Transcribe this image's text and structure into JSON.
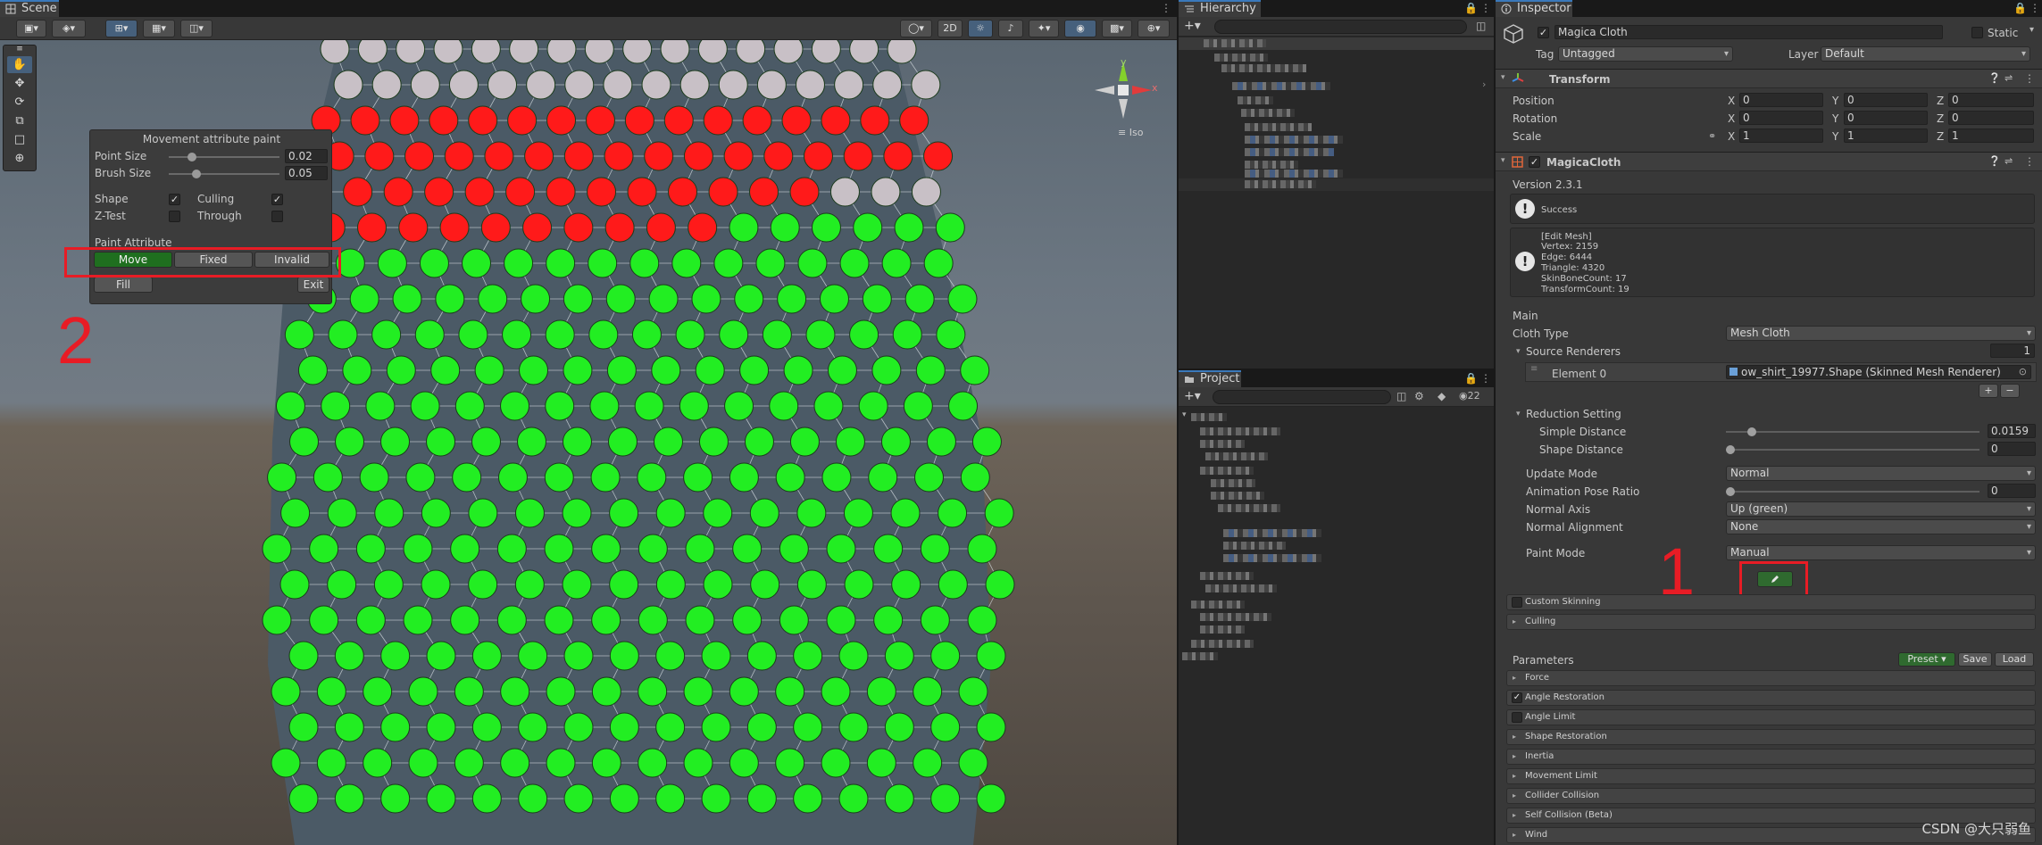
{
  "scene": {
    "tab_label": "Scene",
    "toolbar": {
      "mode_2d": "2D"
    },
    "gizmo": {
      "x_label": "x",
      "y_label": "y",
      "projection": "Iso"
    },
    "colors": {
      "fixed": "#ff1a1a",
      "move": "#22ee22",
      "invalid": "#c8c0c6"
    }
  },
  "paint_panel": {
    "title": "Movement attribute paint",
    "point_size_label": "Point Size",
    "point_size_value": "0.02",
    "brush_size_label": "Brush Size",
    "brush_size_value": "0.05",
    "shape_label": "Shape",
    "culling_label": "Culling",
    "ztest_label": "Z-Test",
    "through_label": "Through",
    "paint_attribute_label": "Paint Attribute",
    "move_label": "Move",
    "fixed_label": "Fixed",
    "invalid_label": "Invalid",
    "fill_label": "Fill",
    "exit_label": "Exit"
  },
  "annotations": {
    "label_1": "1",
    "label_2": "2"
  },
  "hierarchy": {
    "tab_label": "Hierarchy"
  },
  "project": {
    "tab_label": "Project",
    "hidden_count": "22"
  },
  "inspector": {
    "tab_label": "Inspector",
    "object_name": "Magica Cloth",
    "static_label": "Static",
    "tag_label": "Tag",
    "tag_value": "Untagged",
    "layer_label": "Layer",
    "layer_value": "Default",
    "transform": {
      "title": "Transform",
      "position_label": "Position",
      "rotation_label": "Rotation",
      "scale_label": "Scale",
      "x": "X",
      "y": "Y",
      "z": "Z",
      "position": [
        "0",
        "0",
        "0"
      ],
      "rotation": [
        "0",
        "0",
        "0"
      ],
      "scale": [
        "1",
        "1",
        "1"
      ]
    },
    "magica": {
      "title": "MagicaCloth",
      "version": "Version 2.3.1",
      "success": "Success",
      "edit_mesh": "[Edit Mesh]",
      "vertex": "Vertex: 2159",
      "edge": "Edge: 6444",
      "triangle": "Triangle: 4320",
      "skin_bone": "SkinBoneCount: 17",
      "transform_count": "TransformCount: 19",
      "main_label": "Main",
      "cloth_type_label": "Cloth Type",
      "cloth_type_value": "Mesh Cloth",
      "source_renderers_label": "Source Renderers",
      "source_renderers_count": "1",
      "element0_label": "Element 0",
      "element0_value": "ow_shirt_19977.Shape (Skinned Mesh Renderer)",
      "reduction_label": "Reduction Setting",
      "simple_distance_label": "Simple Distance",
      "simple_distance_value": "0.0159",
      "shape_distance_label": "Shape Distance",
      "shape_distance_value": "0",
      "update_mode_label": "Update Mode",
      "update_mode_value": "Normal",
      "anim_pose_label": "Animation Pose Ratio",
      "anim_pose_value": "0",
      "normal_axis_label": "Normal Axis",
      "normal_axis_value": "Up (green)",
      "normal_align_label": "Normal Alignment",
      "normal_align_value": "None",
      "paint_mode_label": "Paint Mode",
      "paint_mode_value": "Manual",
      "custom_skinning": "Custom Skinning",
      "culling": "Culling",
      "parameters_label": "Parameters",
      "preset_label": "Preset",
      "save_label": "Save",
      "load_label": "Load",
      "params": [
        "Force",
        "Angle Restoration",
        "Angle Limit",
        "Shape Restoration",
        "Inertia",
        "Movement Limit",
        "Collider Collision",
        "Self Collision (Beta)",
        "Wind"
      ]
    }
  },
  "watermark": "CSDN @大只弱鱼"
}
